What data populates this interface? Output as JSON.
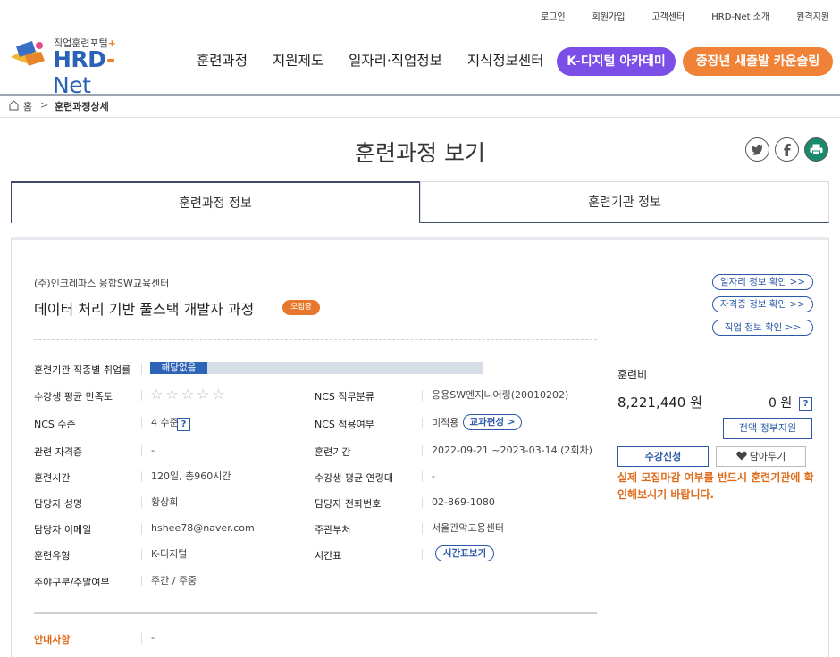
{
  "util_nav": [
    "로그인",
    "회원가입",
    "고객센터",
    "HRD-Net 소개",
    "원격지원"
  ],
  "logo": {
    "subtitle": "직업훈련포털",
    "plus": "+",
    "name_a": "HRD",
    "dash": "-",
    "name_b": "Net"
  },
  "gnb": [
    "훈련과정",
    "지원제도",
    "일자리·직업정보",
    "지식정보센터"
  ],
  "gnb_buttons": {
    "kdigital": "K-디지털 아카데미",
    "career": "중장년 새출발 카운슬링"
  },
  "breadcrumb": {
    "home": "홈",
    "sep": ">",
    "current": "훈련과정상세"
  },
  "page_title": "훈련과정 보기",
  "tabs": [
    "훈련과정 정보",
    "훈련기관 정보"
  ],
  "course": {
    "org": "(주)인크레파스 융합SW교육센터",
    "title": "데이터 처리 기반 풀스택 개발자 과정",
    "badge": "모집중"
  },
  "outlink_buttons": [
    "일자리 정보 확인 >>",
    "자격증 정보 확인 >>",
    "직업 정보 확인 >>"
  ],
  "info": {
    "employment_rate_label": "훈련기관 직종별 취업률",
    "employment_rate_value": "해당없음",
    "satisfaction_label": "수강생 평균 만족도",
    "satisfaction_stars": "☆☆☆☆☆",
    "ncs_cat_label": "NCS 직무분류",
    "ncs_cat_value": "응용SW엔지니어링(20010202)",
    "ncs_level_label": "NCS 수준",
    "ncs_level_value": "4 수준",
    "ncs_apply_label": "NCS 적용여부",
    "ncs_apply_value": "미적용",
    "curriculum_btn": "교과편성 >",
    "cert_label": "관련 자격증",
    "cert_value": "-",
    "period_label": "훈련기간",
    "period_value": "2022-09-21 ~2023-03-14 (2회차)",
    "hours_label": "훈련시간",
    "hours_value": "120일, 총960시간",
    "age_label": "수강생 평균 연령대",
    "age_value": "-",
    "manager_label": "담당자 성명",
    "manager_value": "황상희",
    "phone_label": "담당자 전화번호",
    "phone_value": "02-869-1080",
    "email_label": "담당자 이메일",
    "email_value": "hshee78@naver.com",
    "dept_label": "주관부처",
    "dept_value": "서울관악고용센터",
    "type_label": "훈련유형",
    "type_value": "K-디지털",
    "timetable_label": "시간표",
    "timetable_btn": "시간표보기",
    "daynight_label": "주야구분/주말여부",
    "daynight_value": "주간 / 주중",
    "notice_label": "안내사항",
    "notice_value": "-",
    "help": "?"
  },
  "fee": {
    "label": "훈련비",
    "amount": "8,221,440 원",
    "self_pay": "0 원",
    "gov_btn": "전액 정부지원",
    "apply_btn": "수강신청",
    "wish_btn": "담아두기",
    "notice": "실제 모집마감 여부를 반드시 훈련기관에 확인해보시기 바랍니다."
  }
}
